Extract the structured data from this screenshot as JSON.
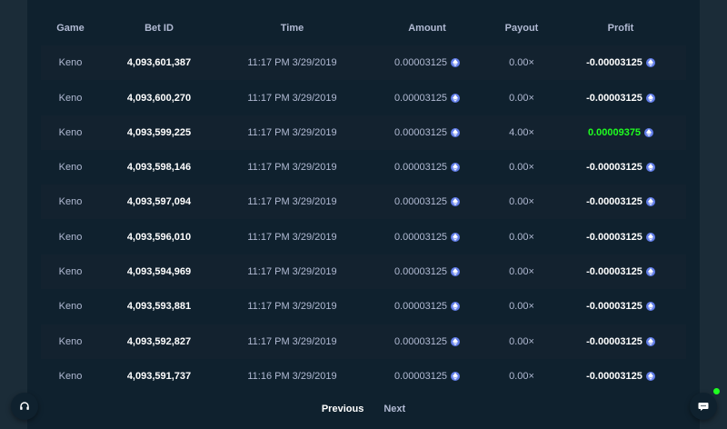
{
  "table": {
    "headers": {
      "game": "Game",
      "bet_id": "Bet ID",
      "time": "Time",
      "amount": "Amount",
      "payout": "Payout",
      "profit": "Profit"
    },
    "rows": [
      {
        "game": "Keno",
        "bet_id": "4,093,601,387",
        "time": "11:17 PM 3/29/2019",
        "amount": "0.00003125",
        "payout": "0.00×",
        "profit": "-0.00003125",
        "win": false
      },
      {
        "game": "Keno",
        "bet_id": "4,093,600,270",
        "time": "11:17 PM 3/29/2019",
        "amount": "0.00003125",
        "payout": "0.00×",
        "profit": "-0.00003125",
        "win": false
      },
      {
        "game": "Keno",
        "bet_id": "4,093,599,225",
        "time": "11:17 PM 3/29/2019",
        "amount": "0.00003125",
        "payout": "4.00×",
        "profit": "0.00009375",
        "win": true
      },
      {
        "game": "Keno",
        "bet_id": "4,093,598,146",
        "time": "11:17 PM 3/29/2019",
        "amount": "0.00003125",
        "payout": "0.00×",
        "profit": "-0.00003125",
        "win": false
      },
      {
        "game": "Keno",
        "bet_id": "4,093,597,094",
        "time": "11:17 PM 3/29/2019",
        "amount": "0.00003125",
        "payout": "0.00×",
        "profit": "-0.00003125",
        "win": false
      },
      {
        "game": "Keno",
        "bet_id": "4,093,596,010",
        "time": "11:17 PM 3/29/2019",
        "amount": "0.00003125",
        "payout": "0.00×",
        "profit": "-0.00003125",
        "win": false
      },
      {
        "game": "Keno",
        "bet_id": "4,093,594,969",
        "time": "11:17 PM 3/29/2019",
        "amount": "0.00003125",
        "payout": "0.00×",
        "profit": "-0.00003125",
        "win": false
      },
      {
        "game": "Keno",
        "bet_id": "4,093,593,881",
        "time": "11:17 PM 3/29/2019",
        "amount": "0.00003125",
        "payout": "0.00×",
        "profit": "-0.00003125",
        "win": false
      },
      {
        "game": "Keno",
        "bet_id": "4,093,592,827",
        "time": "11:17 PM 3/29/2019",
        "amount": "0.00003125",
        "payout": "0.00×",
        "profit": "-0.00003125",
        "win": false
      },
      {
        "game": "Keno",
        "bet_id": "4,093,591,737",
        "time": "11:16 PM 3/29/2019",
        "amount": "0.00003125",
        "payout": "0.00×",
        "profit": "-0.00003125",
        "win": false
      }
    ],
    "currency_icon": "ethereum-icon"
  },
  "pagination": {
    "previous_label": "Previous",
    "next_label": "Next"
  },
  "widgets": {
    "support_icon": "headset-icon",
    "chat_icon": "chat-icon",
    "online_color": "#1fff20"
  },
  "colors": {
    "background": "#1b2c38",
    "panel": "#0f212e",
    "row_alt": "#13222f",
    "text_muted": "#b1bad3",
    "text_bright": "#ffffff",
    "win": "#1fff20",
    "eth": "#627eea"
  }
}
